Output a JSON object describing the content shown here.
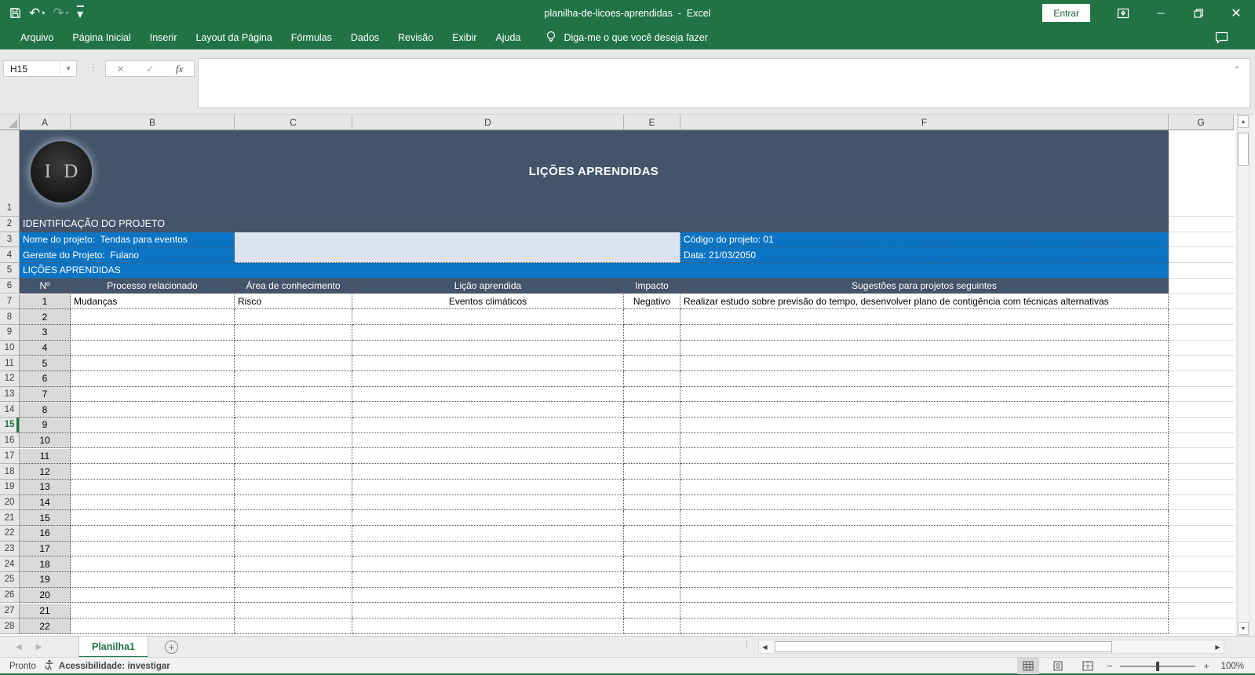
{
  "titlebar": {
    "title": "planilha-de-licoes-aprendidas  -  Excel",
    "signin": "Entrar"
  },
  "ribbon": {
    "tabs": [
      "Arquivo",
      "Página Inicial",
      "Inserir",
      "Layout da Página",
      "Fórmulas",
      "Dados",
      "Revisão",
      "Exibir",
      "Ajuda"
    ],
    "tellme": "Diga-me o que você deseja fazer"
  },
  "formula": {
    "name_box": "H15",
    "cancel": "✕",
    "enter": "✓",
    "fx_label": "fx",
    "content": ""
  },
  "grid": {
    "column_headers": [
      "A",
      "B",
      "C",
      "D",
      "E",
      "F",
      "G"
    ],
    "active_row": 15,
    "row_count": 28,
    "banner": {
      "logo": "I D",
      "title": "LIÇÕES APRENDIDAS"
    },
    "section_project": "IDENTIFICAÇÃO DO PROJETO",
    "project": {
      "name": "Nome do projeto:  Tendas para eventos",
      "code": "Código do projeto: 01",
      "manager": "Gerente do Projeto:  Fulano",
      "date": "Data: 21/03/2050"
    },
    "section_lessons": "LIÇÕES APRENDIDAS",
    "table_headers": [
      "Nº",
      "Processo relacionado",
      "Área de conhecimento",
      "Lição aprendida",
      "Impacto",
      "Sugestões para projetos seguintes"
    ],
    "lesson_rows": [
      {
        "num": "1",
        "processo": "Mudanças",
        "area": "Risco",
        "licao": "Eventos climáticos",
        "impacto": "Negativo",
        "sugestoes": "Realizar estudo sobre previsão do tempo, desenvolver plano de contigência com técnicas alternativas"
      }
    ],
    "empty_rows": [
      "2",
      "3",
      "4",
      "5",
      "6",
      "7",
      "8",
      "9",
      "10",
      "11",
      "12",
      "13",
      "14",
      "15",
      "16",
      "17",
      "18",
      "19",
      "20",
      "21",
      "22"
    ]
  },
  "sheet_tabs": {
    "active": "Planilha1"
  },
  "status": {
    "mode": "Pronto",
    "accessibility": "Acessibilidade: investigar",
    "zoom": "100%"
  },
  "colors": {
    "accent_green": "#217346",
    "banner_slate": "#44546A",
    "blue": "#0B74C4",
    "light_blue": "#DCE3EF",
    "col_a_gray": "#D9D9D9"
  }
}
